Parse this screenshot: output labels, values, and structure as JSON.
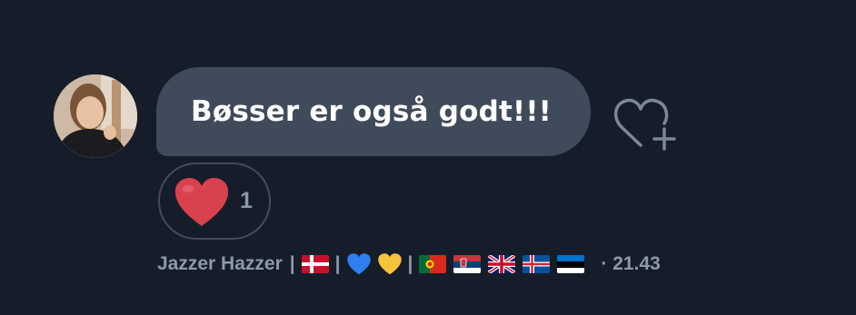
{
  "message": {
    "text": "Bøsser er også godt!!!"
  },
  "reaction": {
    "emoji": "red-heart",
    "count": "1"
  },
  "meta": {
    "sender": "Jazzer Hazzer",
    "separator": "|",
    "emoji_sequence": [
      "flag-denmark",
      "blue-heart",
      "yellow-heart",
      "flag-portugal",
      "flag-serbia",
      "flag-united-kingdom",
      "flag-iceland",
      "flag-estonia"
    ],
    "time": "· 21.43"
  },
  "colors": {
    "background": "#161d2a",
    "bubble": "#3f4a5a",
    "muted_text": "#8e98a7",
    "pill_border": "#424c5b",
    "reaction_heart": "#d9414f"
  },
  "icons": {
    "add_reaction": "heart-plus-icon"
  }
}
